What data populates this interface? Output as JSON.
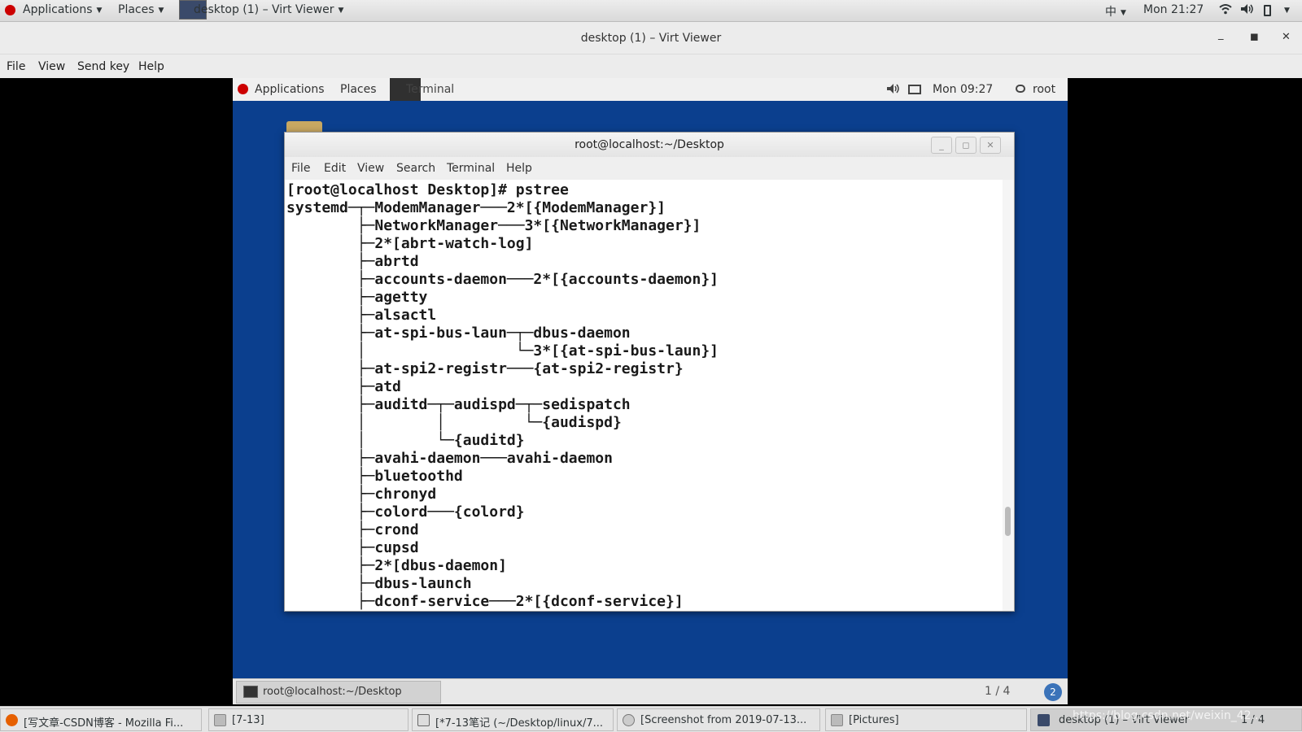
{
  "host_topbar": {
    "applications": "Applications",
    "places": "Places",
    "active_window": "desktop (1) – Virt Viewer",
    "input_method": "中",
    "clock": "Mon 21:27"
  },
  "viewer": {
    "title": "desktop (1) – Virt Viewer",
    "menu": [
      "File",
      "View",
      "Send key",
      "Help"
    ]
  },
  "guest_topbar": {
    "applications": "Applications",
    "places": "Places",
    "terminal": "Terminal",
    "clock": "Mon 09:27",
    "user": "root"
  },
  "terminal": {
    "title": "root@localhost:~/Desktop",
    "menu": [
      "File",
      "Edit",
      "View",
      "Search",
      "Terminal",
      "Help"
    ],
    "output": "[root@localhost Desktop]# pstree\nsystemd─┬─ModemManager───2*[{ModemManager}]\n        ├─NetworkManager───3*[{NetworkManager}]\n        ├─2*[abrt-watch-log]\n        ├─abrtd\n        ├─accounts-daemon───2*[{accounts-daemon}]\n        ├─agetty\n        ├─alsactl\n        ├─at-spi-bus-laun─┬─dbus-daemon\n        │                 └─3*[{at-spi-bus-laun}]\n        ├─at-spi2-registr───{at-spi2-registr}\n        ├─atd\n        ├─auditd─┬─audispd─┬─sedispatch\n        │        │         └─{audispd}\n        │        └─{auditd}\n        ├─avahi-daemon───avahi-daemon\n        ├─bluetoothd\n        ├─chronyd\n        ├─colord───{colord}\n        ├─crond\n        ├─cupsd\n        ├─2*[dbus-daemon]\n        ├─dbus-launch\n        ├─dconf-service───2*[{dconf-service}]"
  },
  "guest_taskbar": {
    "item": "root@localhost:~/Desktop",
    "pager": "1 / 4",
    "workspace_badge": "2"
  },
  "host_taskbar": {
    "items": [
      "[写文章-CSDN博客 - Mozilla Fi...",
      "[7-13]",
      "[*7-13笔记 (~/Desktop/linux/7...",
      "[Screenshot from 2019-07-13...",
      "[Pictures]",
      "desktop (1) – Virt Viewer"
    ],
    "pager": "1 / 4",
    "watermark": "https://blog.csdn.net/weixin_42..."
  },
  "colors": {
    "guest_desktop": "#0b3f8e",
    "redhat": "#cc0000",
    "workspace_badge": "#3b73b9"
  }
}
